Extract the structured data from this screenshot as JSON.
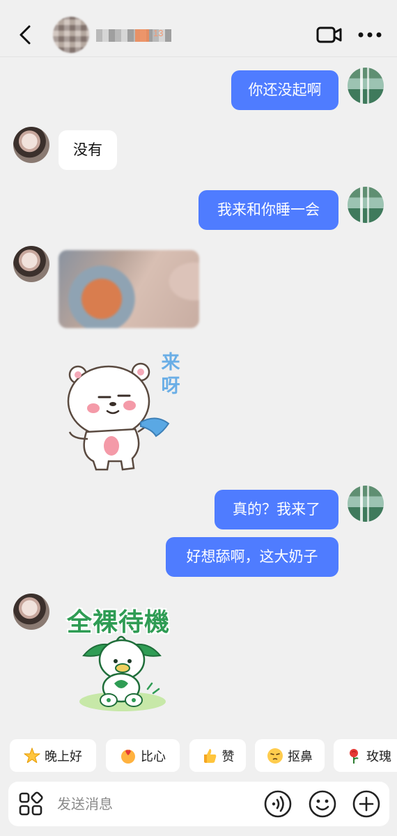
{
  "header": {
    "back_icon": "chevron-left-icon",
    "contact_name": "■■■■",
    "level_badge": "13",
    "video_call_icon": "video-camera-icon",
    "more_icon": "more-dots-icon"
  },
  "messages": [
    {
      "side": "out",
      "type": "text",
      "text": "你还没起啊"
    },
    {
      "side": "in",
      "type": "text",
      "text": "没有"
    },
    {
      "side": "out",
      "type": "text",
      "text": "我来和你睡一会"
    },
    {
      "side": "in",
      "type": "image",
      "image": "photo"
    },
    {
      "side": "in",
      "type": "sticker",
      "sticker_text": "来呀",
      "sticker_icon": "bear-sticker"
    },
    {
      "side": "out",
      "type": "text",
      "text": "真的？我来了"
    },
    {
      "side": "out",
      "type": "text",
      "text": "好想舔啊，这大奶子"
    },
    {
      "side": "in",
      "type": "sticker",
      "sticker_text": "全裸待機",
      "sticker_icon": "dog-sticker"
    }
  ],
  "quick_replies": [
    {
      "label": "晚上好",
      "icon": "star-emoji-icon",
      "color": "#ffc53d"
    },
    {
      "label": "比心",
      "icon": "heart-hands-emoji-icon",
      "color": "#ff9a3c"
    },
    {
      "label": "赞",
      "icon": "thumbs-up-emoji-icon",
      "color": "#ffb020"
    },
    {
      "label": "抠鼻",
      "icon": "nose-pick-emoji-icon",
      "color": "#ffcc4d"
    },
    {
      "label": "玫瑰",
      "icon": "rose-emoji-icon",
      "color": "#e53935"
    }
  ],
  "input_bar": {
    "apps_icon": "apps-grid-icon",
    "placeholder": "发送消息",
    "voice_icon": "voice-icon",
    "emoji_icon": "emoji-icon",
    "plus_icon": "plus-icon"
  },
  "colors": {
    "background": "#f0f0f0",
    "outgoing_bubble": "#4f7cff",
    "incoming_bubble": "#ffffff"
  }
}
